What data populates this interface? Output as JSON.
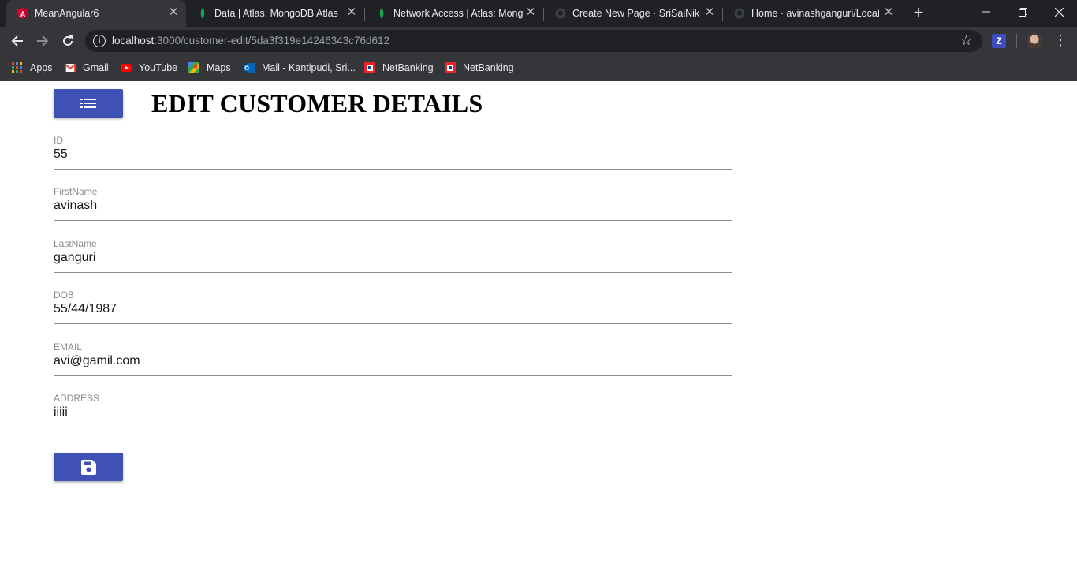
{
  "browser": {
    "tabs": [
      {
        "title": "MeanAngular6",
        "icon": "angular-icon"
      },
      {
        "title": "Data | Atlas: MongoDB Atlas",
        "icon": "mongodb-leaf-icon"
      },
      {
        "title": "Network Access | Atlas: Mongo",
        "icon": "mongodb-leaf-icon"
      },
      {
        "title": "Create New Page · SriSaiNikhil",
        "icon": "github-icon"
      },
      {
        "title": "Home · avinashganguri/Locatic",
        "icon": "github-icon"
      }
    ],
    "url_host": "localhost",
    "url_path": ":3000/customer-edit/5da3f319e14246343c76d612",
    "extension_label": "Z",
    "bookmarks": [
      {
        "label": "Apps",
        "icon": "apps-grid-icon"
      },
      {
        "label": "Gmail",
        "icon": "gmail-icon"
      },
      {
        "label": "YouTube",
        "icon": "youtube-icon"
      },
      {
        "label": "Maps",
        "icon": "maps-icon"
      },
      {
        "label": "Mail - Kantipudi, Sri...",
        "icon": "outlook-icon"
      },
      {
        "label": "NetBanking",
        "icon": "hdfc-bank-icon"
      },
      {
        "label": "NetBanking",
        "icon": "hdfc-bank-icon"
      }
    ]
  },
  "page": {
    "title": "EDIT CUSTOMER DETAILS",
    "list_button_icon": "list-icon",
    "save_button_icon": "save-icon",
    "accent_color": "#3f51b5",
    "fields": [
      {
        "label": "ID",
        "value": "55"
      },
      {
        "label": "FirstName",
        "value": "avinash"
      },
      {
        "label": "LastName",
        "value": "ganguri"
      },
      {
        "label": "DOB",
        "value": "55/44/1987"
      },
      {
        "label": "EMAIL",
        "value": "avi@gamil.com"
      },
      {
        "label": "ADDRESS",
        "value": "iiiii"
      }
    ]
  }
}
